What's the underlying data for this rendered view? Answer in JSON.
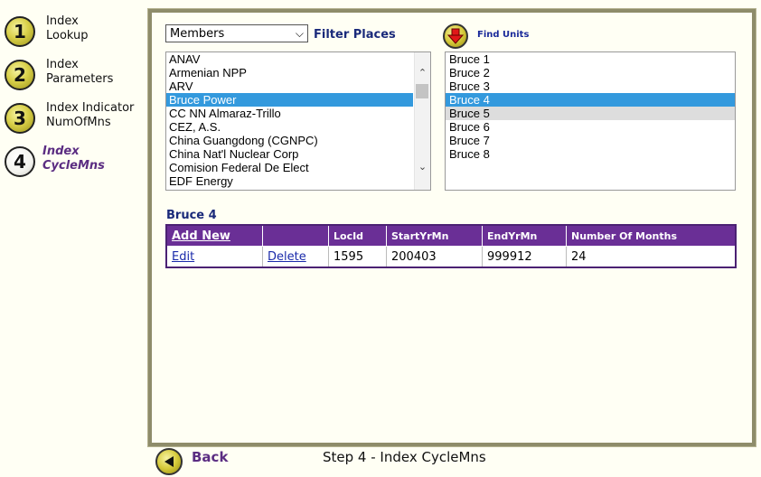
{
  "nav": {
    "steps": [
      {
        "number": "1",
        "line1": "Index",
        "line2": "Lookup"
      },
      {
        "number": "2",
        "line1": "Index",
        "line2": "Parameters"
      },
      {
        "number": "3",
        "line1": "Index Indicator",
        "line2": "NumOfMns"
      },
      {
        "number": "4",
        "line1": "Index",
        "line2": "CycleMns"
      }
    ]
  },
  "filter": {
    "select_value": "Members",
    "label": "Filter Places",
    "find_label": "Find Units"
  },
  "places": [
    "ANAV",
    "Armenian NPP",
    "ARV",
    "Bruce Power",
    "CC NN Almaraz-Trillo",
    "CEZ, A.S.",
    "China Guangdong (CGNPC)",
    "China Nat'l Nuclear Corp",
    "Comision Federal De Elect",
    "EDF Energy"
  ],
  "units": [
    "Bruce 1",
    "Bruce 2",
    "Bruce 3",
    "Bruce 4",
    "Bruce 5",
    "Bruce 6",
    "Bruce 7",
    "Bruce 8"
  ],
  "selected_unit": "Bruce 4",
  "table": {
    "headers": {
      "add_new": "Add New",
      "blank": "",
      "locid": "LocId",
      "start": "StartYrMn",
      "end": "EndYrMn",
      "months": "Number Of Months"
    },
    "row": {
      "edit": "Edit",
      "delete": "Delete",
      "locid": "1595",
      "start": "200403",
      "end": "999912",
      "months": "24"
    }
  },
  "footer": {
    "back_label": "Back",
    "step_caption": "Step 4 - Index CycleMns"
  },
  "colors": {
    "accent_purple": "#6a2f96",
    "selection_blue": "#3399dd",
    "nav_active": "#5b2d82"
  }
}
